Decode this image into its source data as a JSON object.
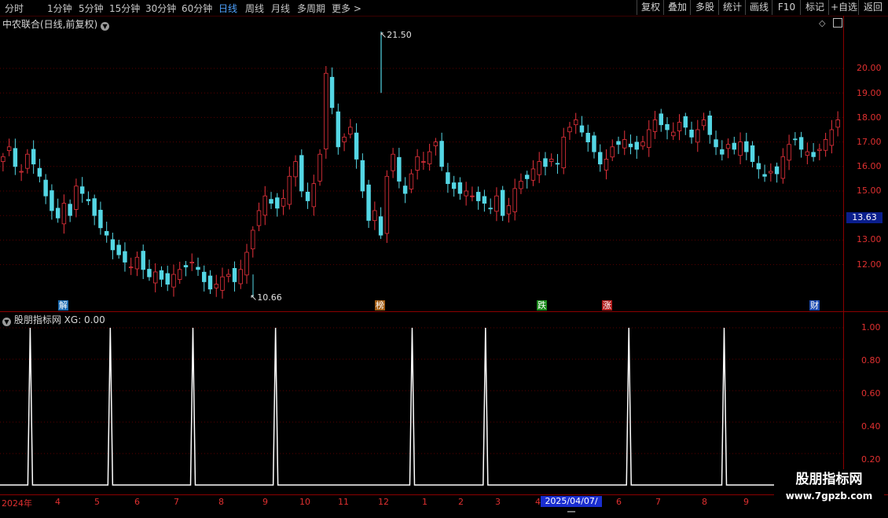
{
  "toolbar": {
    "timeframes": [
      "分时",
      "1分钟",
      "5分钟",
      "15分钟",
      "30分钟",
      "60分钟",
      "日线",
      "周线",
      "月线",
      "多周期",
      "更多"
    ],
    "active_timeframe": "日线",
    "more_arrow": ">",
    "right_buttons": [
      "复权",
      "叠加",
      "多股",
      "统计",
      "画线",
      "F10",
      "标记",
      "+自选",
      "返回"
    ]
  },
  "main_panel": {
    "title": "中农联合(日线,前复权)",
    "max_price_label": "21.50",
    "min_price_label": "10.66",
    "current_price": "13.63",
    "y_ticks": [
      "20.00",
      "19.00",
      "18.00",
      "17.00",
      "16.00",
      "15.00",
      "13.00",
      "12.00"
    ],
    "event_badges": [
      {
        "text": "解",
        "color": "#1a6ab0"
      },
      {
        "text": "榜",
        "color": "#a05a10"
      },
      {
        "text": "跌",
        "color": "#1a8a1a"
      },
      {
        "text": "涨",
        "color": "#b01a1a"
      },
      {
        "text": "财",
        "color": "#1a4ab0"
      }
    ]
  },
  "indicator_panel": {
    "title": "股朋指标网",
    "value_label": "XG: 0.00",
    "y_ticks": [
      "1.00",
      "0.80",
      "0.60",
      "0.40",
      "0.20"
    ]
  },
  "x_axis": {
    "labels": [
      "2024年",
      "4",
      "5",
      "6",
      "7",
      "8",
      "9",
      "10",
      "11",
      "12",
      "1",
      "2",
      "3",
      "4",
      "6",
      "7",
      "8",
      "9"
    ],
    "current_date": "2025/04/07/一"
  },
  "watermark": {
    "line1": "股朋指标网",
    "line2": "www.7gpzb.com"
  },
  "colors": {
    "up": "#e8323c",
    "down": "#54d6e4",
    "frame": "#8b0000",
    "active_tab": "#4fa3ff"
  },
  "icons": [
    "dropdown-icon",
    "diamond-icon",
    "panel-toggle-icon",
    "arrow-pointer-icon"
  ],
  "chart_data": {
    "type": "candlestick",
    "series": [
      {
        "values": [
          16.4,
          16.8,
          16.0,
          15.8,
          16.5,
          16.1,
          15.6,
          14.8,
          14.2,
          13.9,
          14.5,
          14.0,
          15.2,
          14.9,
          14.6,
          14.0,
          13.5,
          13.2,
          12.6,
          12.4,
          12.1,
          11.9,
          12.3,
          11.8,
          11.5,
          11.7,
          11.4,
          11.2,
          11.6,
          11.8,
          11.9,
          12.1,
          11.8,
          11.3,
          11.0,
          11.2,
          11.5,
          11.6,
          11.3,
          11.8,
          12.5,
          13.4,
          14.2,
          14.8,
          14.5,
          14.3,
          14.7,
          15.6,
          16.2,
          15.0,
          14.6,
          15.3,
          16.5,
          19.8,
          18.4,
          16.8,
          17.2,
          17.6,
          16.3,
          15.0,
          13.8,
          14.2,
          13.2,
          15.6,
          16.5,
          15.4,
          14.9,
          15.7,
          16.4,
          16.2,
          16.6,
          17.0,
          16.0,
          15.3,
          15.1,
          14.9,
          15.0,
          14.8,
          14.6,
          14.5,
          14.3,
          14.8,
          14.0,
          14.4,
          15.1,
          15.4,
          15.5,
          15.9,
          16.2,
          16.0,
          16.3,
          16.1,
          17.2,
          17.6,
          17.9,
          17.4,
          17.0,
          16.6,
          16.1,
          16.3,
          16.8,
          16.9,
          17.1,
          16.8,
          16.7,
          17.0,
          17.5,
          17.9,
          17.7,
          17.5,
          17.4,
          17.8,
          17.6,
          17.2,
          17.5,
          17.9,
          17.3,
          16.8,
          16.5,
          16.9,
          16.7,
          17.0,
          16.6,
          16.2,
          15.9,
          15.6,
          15.8,
          15.7,
          16.4,
          16.9,
          17.1,
          16.7,
          16.6,
          16.4,
          16.7,
          17.1,
          17.5,
          17.9
        ]
      }
    ],
    "price_labels": {
      "max": 21.5,
      "min": 10.66,
      "current": 13.63
    },
    "indicator": {
      "name": "XG",
      "spike_positions_pct": [
        3.3,
        12.8,
        22.6,
        32.4,
        48.6,
        57.3,
        74.3,
        85.6
      ],
      "ylim": [
        0,
        1
      ]
    },
    "ylim": [
      11,
      21.5
    ]
  }
}
